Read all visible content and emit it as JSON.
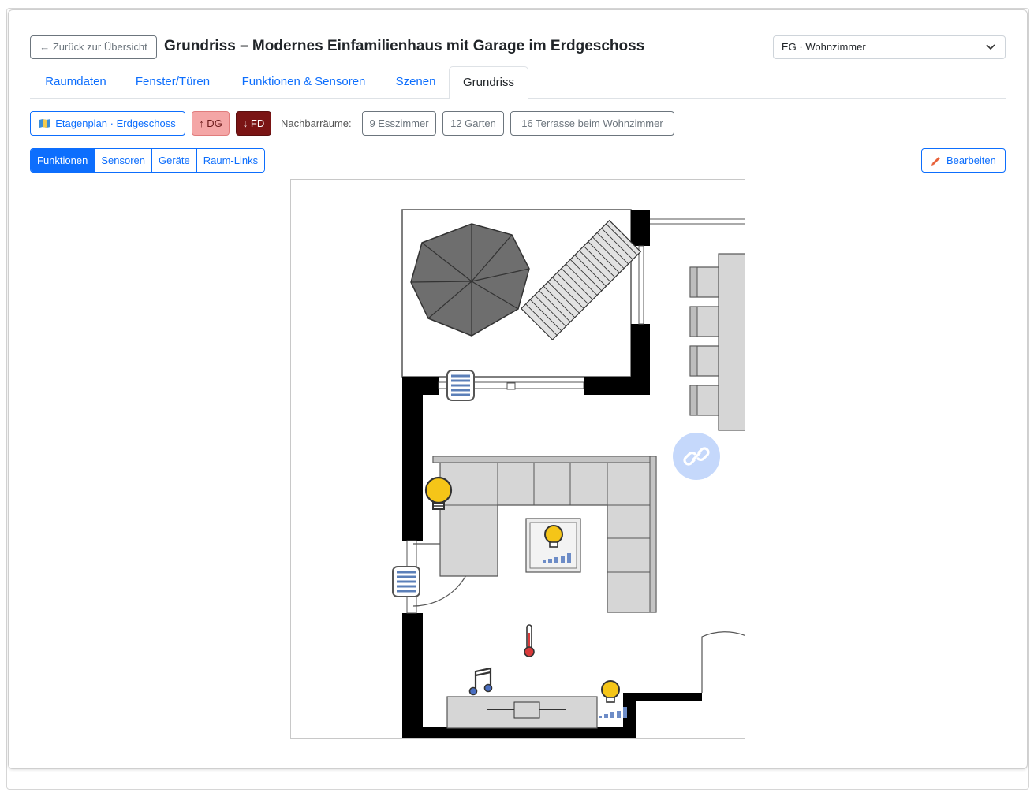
{
  "header": {
    "back_label": "← Zurück zur Übersicht",
    "title": "Grundriss – Modernes Einfamilienhaus mit Garage im Erdgeschoss",
    "room_select_value": "EG · Wohnzimmer"
  },
  "tabs": [
    {
      "label": "Raumdaten"
    },
    {
      "label": "Fenster/Türen"
    },
    {
      "label": "Funktionen & Sensoren"
    },
    {
      "label": "Szenen"
    },
    {
      "label": "Grundriss",
      "active": true
    }
  ],
  "nav": {
    "floorplan_label": "Etagenplan · Erdgeschoss",
    "up_label": "↑ DG",
    "down_label": "↓ FD",
    "neighbors_label": "Nachbarräume:",
    "neighbors": [
      {
        "label": "9 Esszimmer"
      },
      {
        "label": "12 Garten"
      },
      {
        "label": "16 Terrasse beim Wohnzimmer"
      }
    ]
  },
  "view_modes": [
    {
      "label": "Funktionen",
      "active": true
    },
    {
      "label": "Sensoren"
    },
    {
      "label": "Geräte"
    },
    {
      "label": "Raum-Links"
    }
  ],
  "edit_label": "Bearbeiten",
  "markers": [
    {
      "name": "blind-icon",
      "kind": "blind"
    },
    {
      "name": "blind-icon",
      "kind": "blind"
    },
    {
      "name": "lightbulb-icon",
      "kind": "light"
    },
    {
      "name": "lightbulb-icon",
      "kind": "light-dimmer"
    },
    {
      "name": "lightbulb-icon",
      "kind": "light-dimmer"
    },
    {
      "name": "thermometer-icon",
      "kind": "temperature"
    },
    {
      "name": "music-note-icon",
      "kind": "audio"
    },
    {
      "name": "link-icon",
      "kind": "room-link"
    }
  ],
  "colors": {
    "primary": "#0d6efd",
    "dg_badge": "#f4a6a6",
    "fd_badge": "#7a1414",
    "light_on": "#f5c518",
    "edit_pencil": "#e8613a"
  }
}
